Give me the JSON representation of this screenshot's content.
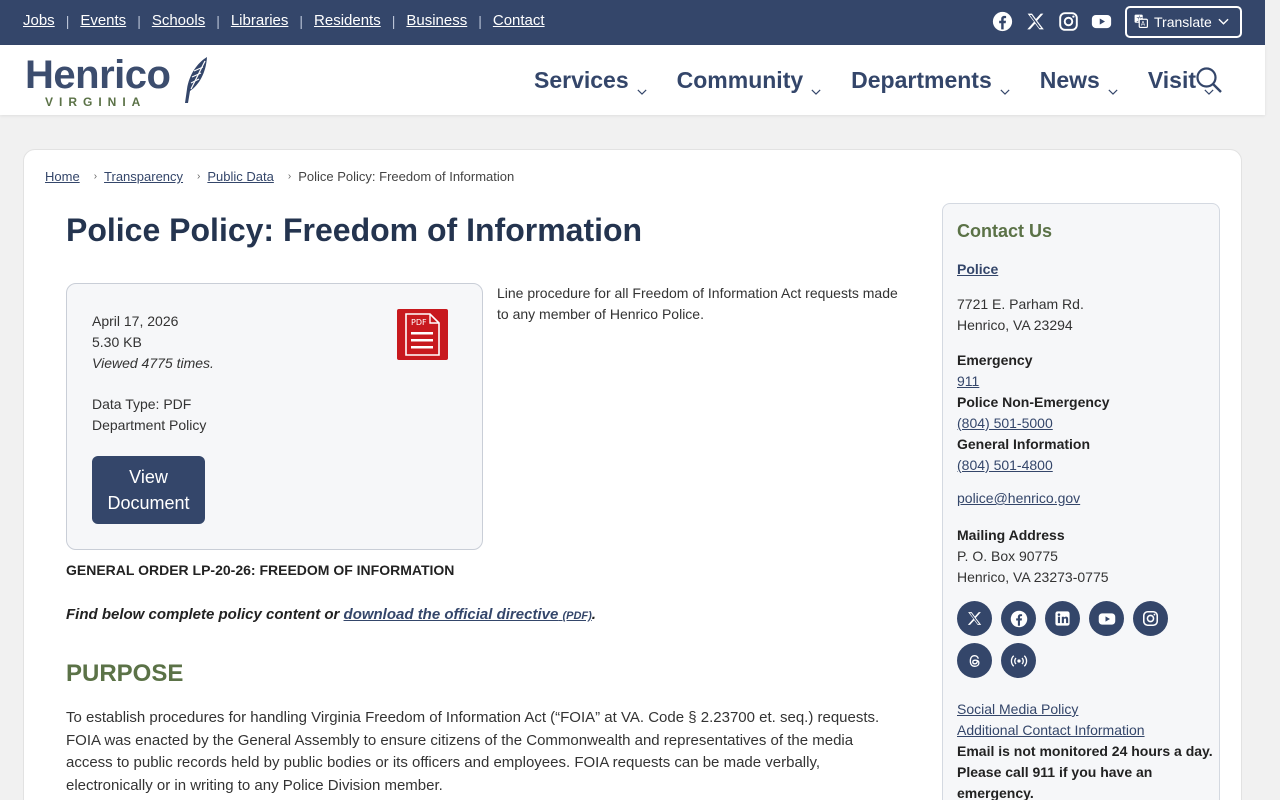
{
  "topbar": {
    "links": [
      {
        "label": "Jobs"
      },
      {
        "label": "Events"
      },
      {
        "label": "Schools"
      },
      {
        "label": "Libraries"
      },
      {
        "label": "Residents"
      },
      {
        "label": "Business"
      },
      {
        "label": "Contact"
      }
    ],
    "social_icons": [
      "facebook-icon",
      "x-icon",
      "instagram-icon",
      "youtube-icon"
    ],
    "translate_label": "Translate"
  },
  "logo": {
    "word": "Henrico",
    "sub": "VIRGINIA"
  },
  "nav": {
    "items": [
      {
        "label": "Services"
      },
      {
        "label": "Community"
      },
      {
        "label": "Departments"
      },
      {
        "label": "News"
      },
      {
        "label": "Visit"
      }
    ]
  },
  "breadcrumb": {
    "items": [
      {
        "label": "Home"
      },
      {
        "label": "Transparency"
      },
      {
        "label": "Public Data"
      }
    ],
    "current": "Police Policy: Freedom of Information",
    "separator": "›"
  },
  "page": {
    "title": "Police Policy: Freedom of Information",
    "document": {
      "date": "April 17, 2026",
      "size": "5.30 KB",
      "views": "Viewed 4775 times.",
      "data_type": "Data Type: PDF",
      "category": "Department Policy",
      "pdf_icon_text": "PDF",
      "view_button_line1": "View",
      "view_button_line2": "Document"
    },
    "description": "Line procedure for all Freedom of Information Act requests made to any member of Henrico Police.",
    "general_order": "GENERAL ORDER LP-20-26: FREEDOM OF INFORMATION",
    "find_below_prefix": "Find below complete policy content or ",
    "find_below_link": "download the official directive",
    "find_below_pdf": "(PDF)",
    "find_below_suffix": ".",
    "purpose_heading": "PURPOSE",
    "purpose_text": "To establish procedures for handling Virginia Freedom of Information Act (“FOIA” at VA. Code § 2.23700 et. seq.) requests. FOIA was enacted by the General Assembly to ensure citizens of the Commonwealth and representatives of the media access to public records held by public bodies or its officers and employees. FOIA requests can be made verbally, electronically or in writing to any Police Division member."
  },
  "contact": {
    "heading": "Contact Us",
    "department_link": "Police",
    "address_line1": "7721 E. Parham Rd.",
    "address_line2": "Henrico, VA 23294",
    "emergency_label": "Emergency",
    "emergency_number": "911",
    "non_emergency_label": "Police Non-Emergency",
    "non_emergency_number": "(804) 501-5000",
    "general_label": "General Information",
    "general_number": "(804) 501-4800",
    "email": "police@henrico.gov",
    "mailing_label": "Mailing Address",
    "mailing_line1": "P. O. Box 90775",
    "mailing_line2": "Henrico, VA 23273-0775",
    "social_icons": [
      "x-icon",
      "facebook-icon",
      "linkedin-icon",
      "youtube-icon",
      "instagram-icon",
      "threads-icon",
      "broadcast-icon"
    ],
    "social_policy_link": "Social Media Policy ",
    "additional_contact_link": "Additional Contact Information",
    "notice": "Email is not monitored 24 hours a day. Please call 911 if you have an emergency."
  },
  "colors": {
    "navy": "#34466a",
    "green": "#5b7247",
    "pdf_red": "#c8191e"
  }
}
